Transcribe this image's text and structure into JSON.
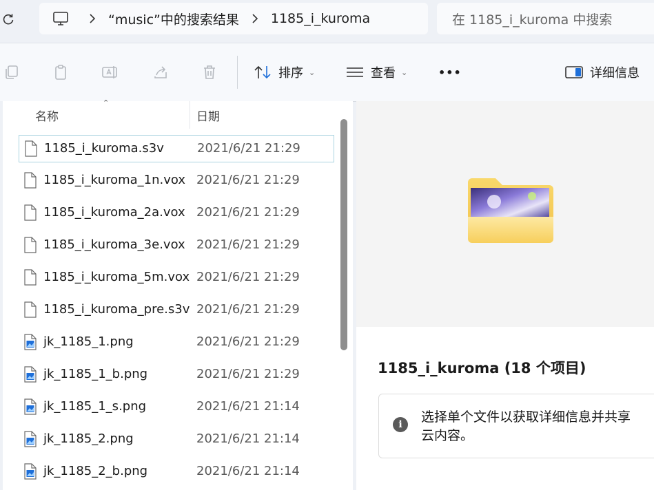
{
  "address": {
    "crumbs": [
      "“music”中的搜索结果",
      "1185_i_kuroma"
    ],
    "search_placeholder": "在 1185_i_kuroma 中搜索"
  },
  "toolbar": {
    "sort_label": "排序",
    "view_label": "查看",
    "more_label": "•••",
    "details_label": "详细信息"
  },
  "list": {
    "columns": {
      "name": "名称",
      "date": "日期"
    },
    "files": [
      {
        "name": "1185_i_kuroma.s3v",
        "date": "2021/6/21 21:29",
        "kind": "doc"
      },
      {
        "name": "1185_i_kuroma_1n.vox",
        "date": "2021/6/21 21:29",
        "kind": "doc"
      },
      {
        "name": "1185_i_kuroma_2a.vox",
        "date": "2021/6/21 21:29",
        "kind": "doc"
      },
      {
        "name": "1185_i_kuroma_3e.vox",
        "date": "2021/6/21 21:29",
        "kind": "doc"
      },
      {
        "name": "1185_i_kuroma_5m.vox",
        "date": "2021/6/21 21:29",
        "kind": "doc"
      },
      {
        "name": "1185_i_kuroma_pre.s3v",
        "date": "2021/6/21 21:29",
        "kind": "doc"
      },
      {
        "name": "jk_1185_1.png",
        "date": "2021/6/21 21:29",
        "kind": "image"
      },
      {
        "name": "jk_1185_1_b.png",
        "date": "2021/6/21 21:29",
        "kind": "image"
      },
      {
        "name": "jk_1185_1_s.png",
        "date": "2021/6/21 21:14",
        "kind": "image"
      },
      {
        "name": "jk_1185_2.png",
        "date": "2021/6/21 21:14",
        "kind": "image"
      },
      {
        "name": "jk_1185_2_b.png",
        "date": "2021/6/21 21:14",
        "kind": "image"
      }
    ]
  },
  "preview": {
    "title": "1185_i_kuroma (18 个项目)",
    "info": "选择单个文件以获取详细信息并共享云内容。"
  },
  "colors": {
    "selection_border": "#a9d3e0",
    "folder_yellow": "#f5c542",
    "accent_blue": "#1e6fd9"
  }
}
